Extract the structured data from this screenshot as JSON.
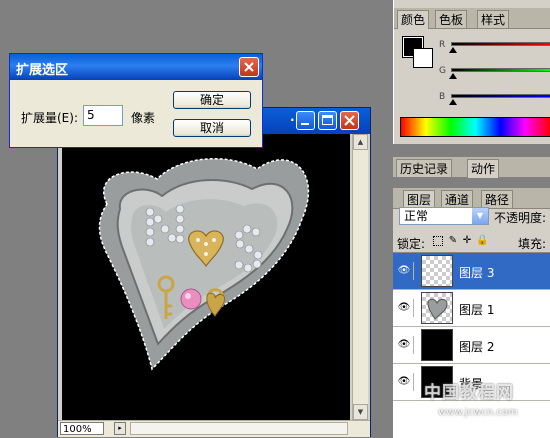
{
  "dialog": {
    "title": "扩展选区",
    "expand_label": "扩展量(E):",
    "expand_value": "5",
    "unit": "像素",
    "ok_label": "确定",
    "cancel_label": "取消"
  },
  "document": {
    "zoom": "100%",
    "title_dots": "..."
  },
  "color_panel": {
    "tabs": [
      "颜色",
      "色板",
      "样式"
    ],
    "channels": [
      "R",
      "G",
      "B"
    ]
  },
  "history_panel": {
    "tabs": [
      "历史记录",
      "动作"
    ]
  },
  "layers_panel": {
    "tabs": [
      "图层",
      "通道",
      "路径"
    ],
    "blend_mode": "正常",
    "opacity_label": "不透明度:",
    "lock_label": "锁定:",
    "fill_label": "填充:",
    "layers": [
      {
        "name": "图层 3",
        "selected": true
      },
      {
        "name": "图层 1",
        "selected": false
      },
      {
        "name": "图层 2",
        "selected": false
      },
      {
        "name": "背景",
        "selected": false
      }
    ]
  },
  "watermark": {
    "text": "中国教程网",
    "url": "www.jcwcn.com"
  }
}
